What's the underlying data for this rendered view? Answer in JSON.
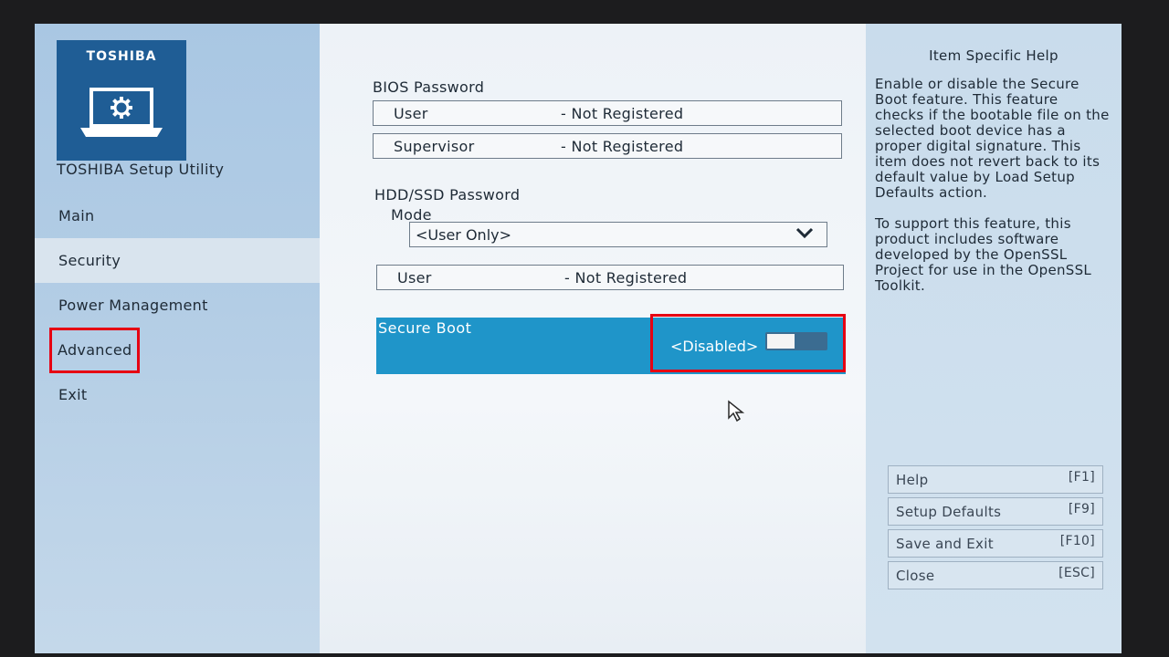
{
  "brand": {
    "logo_text": "TOSHIBA",
    "app_title": "TOSHIBA Setup Utility"
  },
  "menu": {
    "items": [
      {
        "label": "Main"
      },
      {
        "label": "Security",
        "active": true
      },
      {
        "label": "Power Management"
      },
      {
        "label": "Advanced",
        "highlighted": true
      },
      {
        "label": "Exit"
      }
    ]
  },
  "bios_password": {
    "title": "BIOS Password",
    "user": {
      "label": "User",
      "value": "- Not Registered"
    },
    "supervisor": {
      "label": "Supervisor",
      "value": "- Not Registered"
    }
  },
  "hdd_password": {
    "title": "HDD/SSD Password",
    "mode_label": "Mode",
    "mode_value": "<User Only>",
    "user": {
      "label": "User",
      "value": "- Not Registered"
    }
  },
  "secure_boot": {
    "label": "Secure Boot",
    "value": "<Disabled>",
    "enabled": false
  },
  "help": {
    "title": "Item Specific Help",
    "para1": "Enable or disable the Secure Boot feature. This feature checks if the bootable file on the selected boot device has a proper digital signature. This item does not revert back to its default value by Load Setup Defaults action.",
    "para2": "To support this feature, this product includes software developed by the OpenSSL Project for use in the OpenSSL Toolkit."
  },
  "keys": [
    {
      "label": "Help",
      "key": "[F1]"
    },
    {
      "label": "Setup Defaults",
      "key": "[F9]"
    },
    {
      "label": "Save and Exit",
      "key": "[F10]"
    },
    {
      "label": "Close",
      "key": "[ESC]"
    }
  ],
  "colors": {
    "highlight": "#1f95c9",
    "annotation": "#e60012",
    "logo_bg": "#1f5d95"
  },
  "icons": [
    "laptop-gear-icon",
    "chevron-down-icon",
    "mouse-cursor-icon"
  ]
}
